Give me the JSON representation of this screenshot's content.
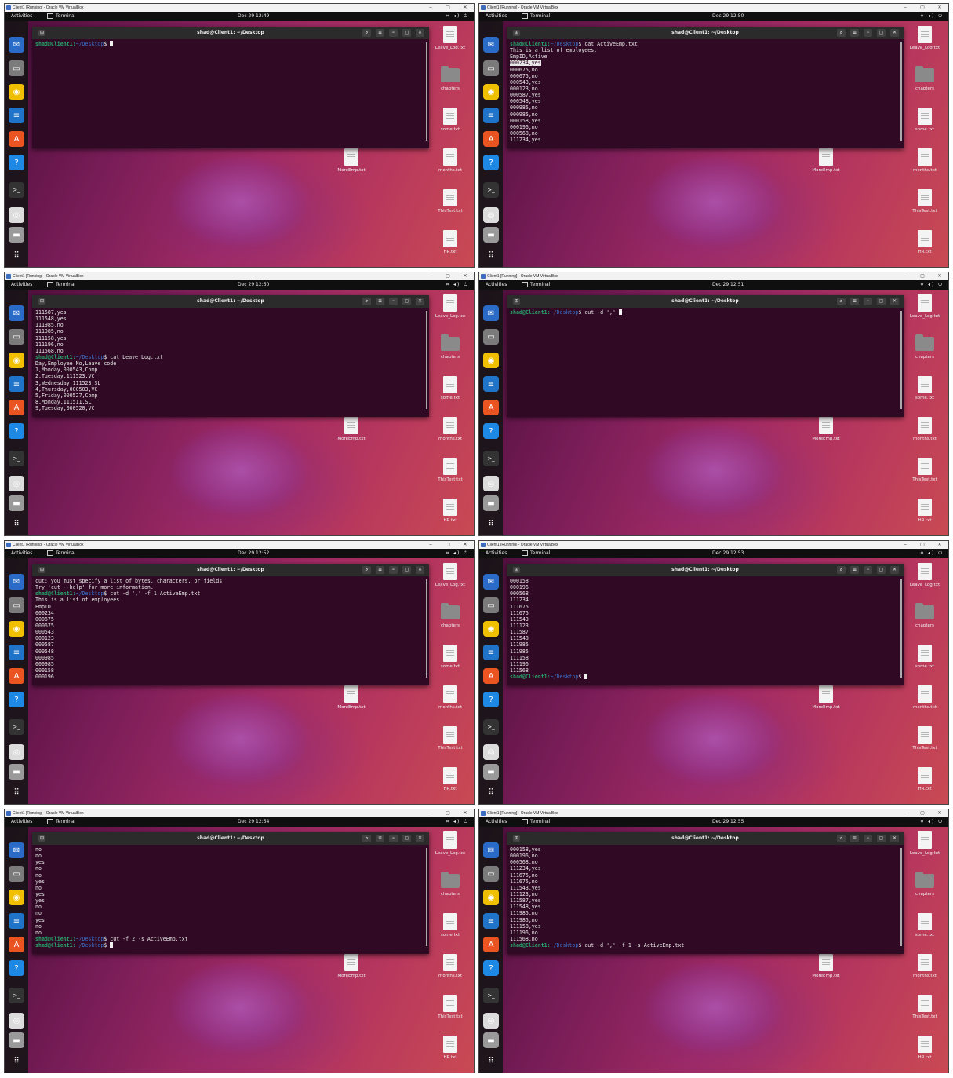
{
  "window_title": "Client1 [Running] - Oracle VM VirtualBox",
  "window_controls": [
    "–",
    "▢",
    "✕"
  ],
  "activities_label": "Activities",
  "app_menu_label": "Terminal",
  "terminal_title": "shad@Client1: ~/Desktop",
  "tray_icons": "⌗ ◂) ⏻",
  "prompt_user": "shad@Client1:",
  "prompt_path": "~/Desktop",
  "prompt_symbol": "$ ",
  "dock_icons": [
    "thunderbird-icon",
    "files-icon",
    "rhythmbox-icon",
    "writer-icon",
    "software-icon",
    "help-icon",
    "terminal-icon",
    "disc-icon",
    "drive-icon",
    "apps-grid-icon"
  ],
  "desktop_files": [
    {
      "label": "Leave_Log.txt",
      "kind": "file"
    },
    {
      "label": "chapters",
      "kind": "folder"
    },
    {
      "label": "some.txt",
      "kind": "file"
    },
    {
      "label": "months.txt",
      "kind": "file"
    },
    {
      "label": "ThisTest.txt",
      "kind": "file"
    },
    {
      "label": "HR.txt",
      "kind": "file"
    }
  ],
  "more_emp_label": "MoreEmp.txt",
  "panels": [
    {
      "clock": "Dec 29  12:49",
      "lines": [
        {
          "prompt": true,
          "cmd": "",
          "cursor": true
        }
      ]
    },
    {
      "clock": "Dec 29  12:50",
      "lines": [
        {
          "prompt": true,
          "cmd": "cat ActiveEmp.txt"
        },
        {
          "text": "This is a list of employees."
        },
        {
          "text": "EmpID,Active"
        },
        {
          "text": "000234,yes",
          "highlight": true
        },
        {
          "text": "000675,no"
        },
        {
          "text": "000675,no"
        },
        {
          "text": "000543,yes"
        },
        {
          "text": "000123,no"
        },
        {
          "text": "000587,yes"
        },
        {
          "text": "000548,yes"
        },
        {
          "text": "000985,no"
        },
        {
          "text": "000985,no"
        },
        {
          "text": "000158,yes"
        },
        {
          "text": "000196,no"
        },
        {
          "text": "000568,no"
        },
        {
          "text": "111234,yes"
        }
      ]
    },
    {
      "clock": "Dec 29  12:50",
      "lines": [
        {
          "text": "111587,yes"
        },
        {
          "text": "111548,yes"
        },
        {
          "text": "111985,no"
        },
        {
          "text": "111985,no"
        },
        {
          "text": "111158,yes"
        },
        {
          "text": "111196,no"
        },
        {
          "text": "111568,no"
        },
        {
          "prompt": true,
          "cmd": "cat Leave_Log.txt"
        },
        {
          "text": "Day,Employee No,Leave code"
        },
        {
          "text": "1,Monday,000543,Comp"
        },
        {
          "text": "2,Tuesday,111523,VC"
        },
        {
          "text": "3,Wednesday,111523,SL"
        },
        {
          "text": "4,Thursday,000503,VC"
        },
        {
          "text": "5,Friday,000527,Comp"
        },
        {
          "text": "8,Monday,111511,SL"
        },
        {
          "text": "9,Tuesday,000520,VC"
        }
      ]
    },
    {
      "clock": "Dec 29  12:51",
      "lines": [
        {
          "prompt": true,
          "cmd": "cut -d ',' ",
          "cursor": true
        }
      ]
    },
    {
      "clock": "Dec 29  12:52",
      "lines": [
        {
          "text": "cut: you must specify a list of bytes, characters, or fields"
        },
        {
          "text": "Try 'cut --help' for more information."
        },
        {
          "prompt": true,
          "cmd": "cut -d ',' -f 1 ActiveEmp.txt"
        },
        {
          "text": "This is a list of employees."
        },
        {
          "text": "EmpID"
        },
        {
          "text": "000234"
        },
        {
          "text": "000675"
        },
        {
          "text": "000675"
        },
        {
          "text": "000543"
        },
        {
          "text": "000123"
        },
        {
          "text": "000587"
        },
        {
          "text": "000548"
        },
        {
          "text": "000985"
        },
        {
          "text": "000985"
        },
        {
          "text": "000158"
        },
        {
          "text": "000196"
        }
      ]
    },
    {
      "clock": "Dec 29  12:53",
      "lines": [
        {
          "text": "000158"
        },
        {
          "text": "000196"
        },
        {
          "text": "000568"
        },
        {
          "text": "111234"
        },
        {
          "text": "111675"
        },
        {
          "text": "111675"
        },
        {
          "text": "111543"
        },
        {
          "text": "111123"
        },
        {
          "text": "111587"
        },
        {
          "text": "111548"
        },
        {
          "text": "111985"
        },
        {
          "text": "111985"
        },
        {
          "text": "111158"
        },
        {
          "text": "111196"
        },
        {
          "text": "111568"
        },
        {
          "prompt": true,
          "cmd": "",
          "cursor": true
        }
      ]
    },
    {
      "clock": "Dec 29  12:54",
      "lines": [
        {
          "text": "no"
        },
        {
          "text": "no"
        },
        {
          "text": "yes"
        },
        {
          "text": "no"
        },
        {
          "text": "no"
        },
        {
          "text": "yes"
        },
        {
          "text": "no"
        },
        {
          "text": "yes"
        },
        {
          "text": "yes"
        },
        {
          "text": "no"
        },
        {
          "text": "no"
        },
        {
          "text": "yes"
        },
        {
          "text": "no"
        },
        {
          "text": "no"
        },
        {
          "prompt": true,
          "cmd": "cut -f 2 -s ActiveEmp.txt"
        },
        {
          "prompt": true,
          "cmd": "",
          "cursor": true
        }
      ]
    },
    {
      "clock": "Dec 29  12:55",
      "lines": [
        {
          "text": "000158,yes"
        },
        {
          "text": "000196,no"
        },
        {
          "text": "000568,no"
        },
        {
          "text": "111234,yes"
        },
        {
          "text": "111675,no"
        },
        {
          "text": "111675,no"
        },
        {
          "text": "111543,yes"
        },
        {
          "text": "111123,no"
        },
        {
          "text": "111587,yes"
        },
        {
          "text": "111548,yes"
        },
        {
          "text": "111985,no"
        },
        {
          "text": "111985,no"
        },
        {
          "text": "111158,yes"
        },
        {
          "text": "111196,no"
        },
        {
          "text": "111568,no"
        },
        {
          "prompt": true,
          "cmd": "cut -d ',' -f 1 -s ActiveEmp.txt"
        }
      ]
    }
  ]
}
